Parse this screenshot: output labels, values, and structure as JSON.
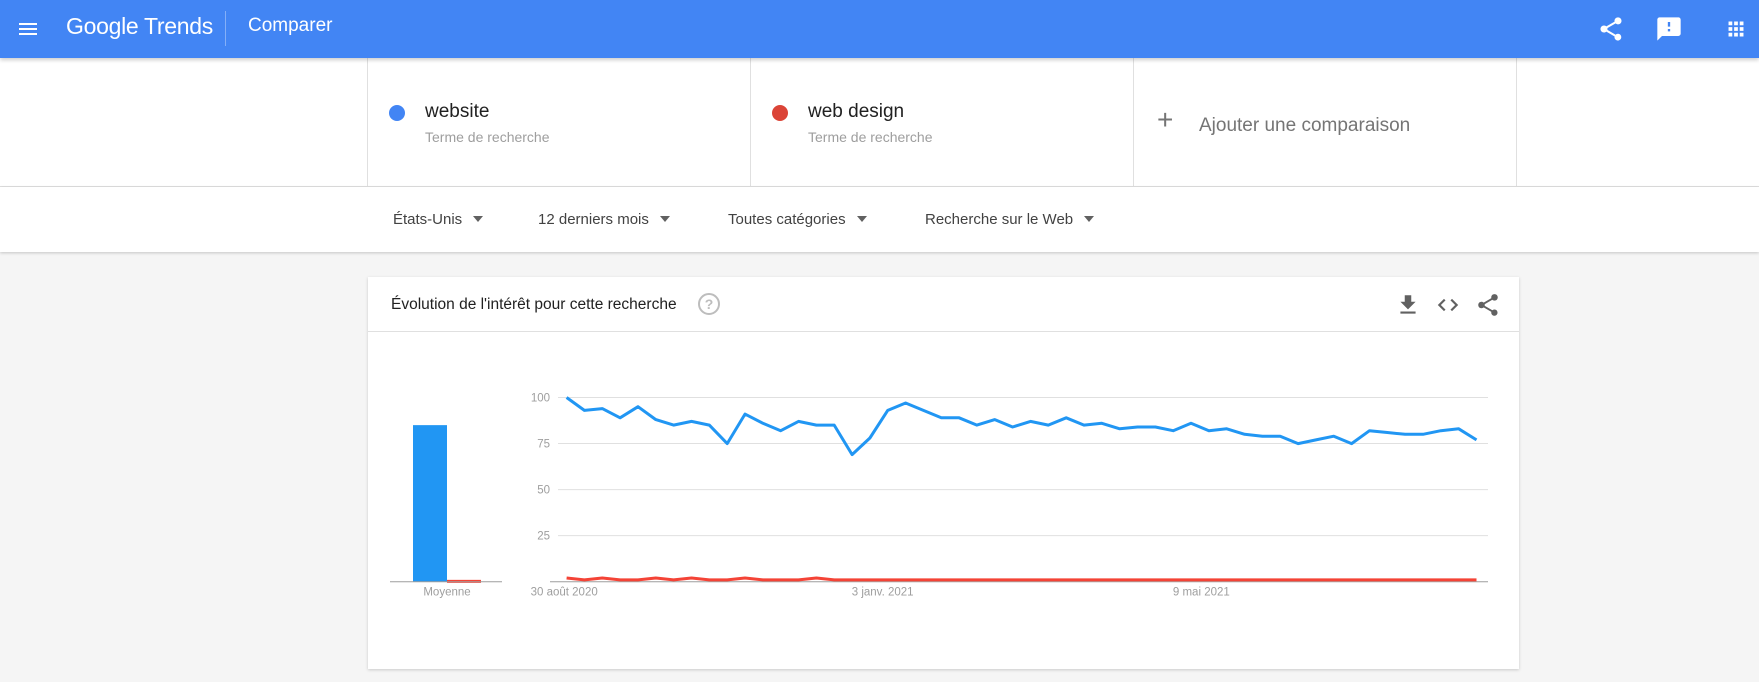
{
  "header": {
    "app_name": "Google Trends",
    "page_title": "Comparer",
    "icons": [
      "menu-icon",
      "share-icon",
      "feedback-icon",
      "apps-icon"
    ]
  },
  "terms": [
    {
      "name": "website",
      "type": "Terme de recherche",
      "color": "#4285f4"
    },
    {
      "name": "web design",
      "type": "Terme de recherche",
      "color": "#db4437"
    }
  ],
  "add_comparison": {
    "label": "Ajouter une comparaison",
    "icon": "plus-icon"
  },
  "filters": [
    {
      "label": "États-Unis"
    },
    {
      "label": "12 derniers mois"
    },
    {
      "label": "Toutes catégories"
    },
    {
      "label": "Recherche sur le Web"
    }
  ],
  "card": {
    "title": "Évolution de l'intérêt pour cette recherche",
    "help_icon": "?",
    "actions": [
      "download-icon",
      "embed-icon",
      "share-icon"
    ]
  },
  "chart_data": {
    "type": "line",
    "title": "Évolution de l'intérêt pour cette recherche",
    "xlabel": "",
    "ylabel": "",
    "ylim": [
      0,
      100
    ],
    "yticks": [
      25,
      50,
      75,
      100
    ],
    "ytick_labels": [
      "25",
      "50",
      "75",
      "100"
    ],
    "x_tick_labels": [
      {
        "index": 0,
        "label": "30 août 2020"
      },
      {
        "index": 18,
        "label": "3 janv. 2021"
      },
      {
        "index": 36,
        "label": "9 mai 2021"
      }
    ],
    "grid": true,
    "series": [
      {
        "name": "website",
        "color": "#2196f3",
        "values": [
          100,
          93,
          94,
          89,
          95,
          88,
          85,
          87,
          85,
          75,
          91,
          86,
          82,
          87,
          85,
          85,
          69,
          78,
          93,
          97,
          93,
          89,
          89,
          85,
          88,
          84,
          87,
          85,
          89,
          85,
          86,
          83,
          84,
          84,
          82,
          86,
          82,
          83,
          80,
          79,
          79,
          75,
          77,
          79,
          75,
          82,
          81,
          80,
          80,
          82,
          83,
          77
        ]
      },
      {
        "name": "web design",
        "color": "#f44336",
        "values": [
          2,
          1,
          2,
          1,
          1,
          2,
          1,
          2,
          1,
          1,
          2,
          1,
          1,
          1,
          2,
          1,
          1,
          1,
          1,
          1,
          1,
          1,
          1,
          1,
          1,
          1,
          1,
          1,
          1,
          1,
          1,
          1,
          1,
          1,
          1,
          1,
          1,
          1,
          1,
          1,
          1,
          1,
          1,
          1,
          1,
          1,
          1,
          1,
          1,
          1,
          1,
          1
        ]
      }
    ],
    "averages": {
      "label": "Moyenne",
      "values": [
        {
          "name": "website",
          "value": 85
        },
        {
          "name": "web design",
          "value": 1
        }
      ]
    }
  }
}
